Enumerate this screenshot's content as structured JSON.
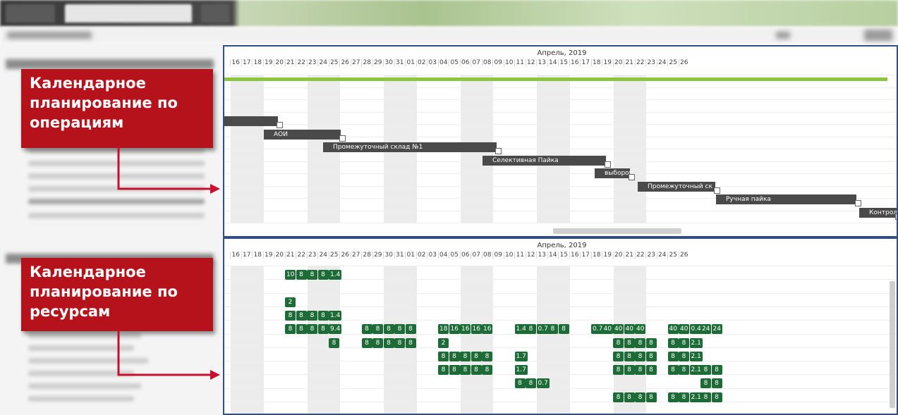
{
  "callouts": {
    "operations": [
      "Календарное",
      "планирование по",
      "операциям"
    ],
    "resources": [
      "Календарное",
      "планирование по",
      "ресурсам"
    ]
  },
  "calendar": {
    "month_label": "Апрель, 2019",
    "days": [
      "16",
      "17",
      "18",
      "19",
      "20",
      "21",
      "22",
      "23",
      "24",
      "25",
      "26",
      "27",
      "28",
      "29",
      "30",
      "31",
      "01",
      "02",
      "03",
      "04",
      "05",
      "06",
      "07",
      "08",
      "09",
      "10",
      "11",
      "12",
      "13",
      "14",
      "15",
      "16",
      "17",
      "18",
      "19",
      "20",
      "21",
      "22",
      "23",
      "24",
      "25",
      "26"
    ]
  },
  "operations": [
    {
      "label": "",
      "row": 0
    },
    {
      "label": "АОИ",
      "row": 1
    },
    {
      "label": "Промежуточный склад №1",
      "row": 2
    },
    {
      "label": "Селективная Пайка",
      "row": 3
    },
    {
      "label": "выборочн",
      "row": 4
    },
    {
      "label": "Промежуточный ск",
      "row": 5
    },
    {
      "label": "Ручная пайка",
      "row": 6
    },
    {
      "label": "Контрол",
      "row": 7
    }
  ],
  "resources": [
    {
      "row": 0,
      "cells": [
        [
          "10",
          2
        ],
        [
          "8",
          3
        ],
        [
          "8",
          4
        ],
        [
          "8",
          5
        ],
        [
          "1.4",
          6
        ]
      ]
    },
    {
      "row": 2,
      "cells": [
        [
          "2",
          2
        ]
      ]
    },
    {
      "row": 3,
      "cells": [
        [
          "8",
          2
        ],
        [
          "8",
          3
        ],
        [
          "8",
          4
        ],
        [
          "8",
          5
        ],
        [
          "1.4",
          6
        ]
      ]
    },
    {
      "row": 4,
      "cells": [
        [
          "8",
          2
        ],
        [
          "8",
          3
        ],
        [
          "8",
          4
        ],
        [
          "8",
          5
        ],
        [
          "9.4",
          6
        ],
        [
          "8",
          9
        ],
        [
          "8",
          10
        ],
        [
          "8",
          11
        ],
        [
          "8",
          12
        ],
        [
          "8",
          13
        ],
        [
          "18",
          16
        ],
        [
          "16",
          17
        ],
        [
          "16",
          18
        ],
        [
          "16",
          19
        ],
        [
          "16",
          20
        ],
        [
          "1.4",
          23
        ],
        [
          "8",
          24
        ],
        [
          "0.7",
          25
        ],
        [
          "8",
          26
        ],
        [
          "8",
          27
        ],
        [
          "0.7",
          30
        ],
        [
          "40",
          31
        ],
        [
          "40",
          32
        ],
        [
          "40",
          33
        ],
        [
          "40",
          34
        ],
        [
          "40",
          37
        ],
        [
          "40",
          38
        ],
        [
          "0.4",
          39
        ],
        [
          "24",
          40
        ],
        [
          "24",
          41
        ]
      ]
    },
    {
      "row": 5,
      "cells": [
        [
          "8",
          6
        ],
        [
          "8",
          9
        ],
        [
          "8",
          10
        ],
        [
          "8",
          11
        ],
        [
          "8",
          12
        ],
        [
          "8",
          13
        ],
        [
          "2",
          16
        ],
        [
          "8",
          32
        ],
        [
          "8",
          33
        ],
        [
          "8",
          34
        ],
        [
          "8",
          35
        ],
        [
          "8",
          37
        ],
        [
          "8",
          38
        ],
        [
          "2.1",
          39
        ]
      ]
    },
    {
      "row": 6,
      "cells": [
        [
          "8",
          16
        ],
        [
          "8",
          17
        ],
        [
          "8",
          18
        ],
        [
          "8",
          19
        ],
        [
          "8",
          20
        ],
        [
          "1.7",
          23
        ],
        [
          "8",
          32
        ],
        [
          "8",
          33
        ],
        [
          "8",
          34
        ],
        [
          "8",
          35
        ],
        [
          "8",
          37
        ],
        [
          "8",
          38
        ],
        [
          "2.1",
          39
        ]
      ]
    },
    {
      "row": 7,
      "cells": [
        [
          "8",
          16
        ],
        [
          "8",
          17
        ],
        [
          "8",
          18
        ],
        [
          "8",
          19
        ],
        [
          "8",
          20
        ],
        [
          "1.7",
          23
        ],
        [
          "8",
          32
        ],
        [
          "8",
          33
        ],
        [
          "8",
          34
        ],
        [
          "8",
          35
        ],
        [
          "8",
          37
        ],
        [
          "8",
          38
        ],
        [
          "2.1",
          39
        ],
        [
          "8",
          40
        ],
        [
          "8",
          41
        ]
      ]
    },
    {
      "row": 8,
      "cells": [
        [
          "8",
          23
        ],
        [
          "8",
          24
        ],
        [
          "0.7",
          25
        ],
        [
          "8",
          40
        ],
        [
          "8",
          41
        ]
      ]
    },
    {
      "row": 9,
      "cells": [
        [
          "8",
          32
        ],
        [
          "8",
          33
        ],
        [
          "8",
          34
        ],
        [
          "8",
          35
        ],
        [
          "8",
          37
        ],
        [
          "8",
          38
        ],
        [
          "2.1",
          39
        ],
        [
          "8",
          40
        ],
        [
          "8",
          41
        ]
      ]
    }
  ],
  "colors": {
    "callout": "#b5121b",
    "panel_border": "#2f4f86",
    "resource_cell": "#1d6b36",
    "op_bar": "#4a4a4a",
    "progress_line": "#8cc63f"
  }
}
